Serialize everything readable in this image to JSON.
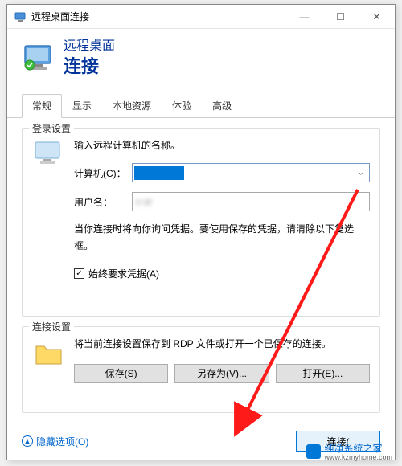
{
  "window_title": "远程桌面连接",
  "header": {
    "line1": "远程桌面",
    "line2": "连接"
  },
  "tabs": [
    "常规",
    "显示",
    "本地资源",
    "体验",
    "高级"
  ],
  "login_group": {
    "title": "登录设置",
    "prompt": "输入远程计算机的名称。",
    "computer_label": "计算机(C)：",
    "computer_value": "",
    "user_label": "用户名：",
    "user_value": "v                                              or",
    "note": "当你连接时将向你询问凭据。要使用保存的凭据，请清除以下复选框。",
    "checkbox_label": "始终要求凭据(A)",
    "checkbox_checked": "☑"
  },
  "connection_group": {
    "title": "连接设置",
    "desc": "将当前连接设置保存到 RDP 文件或打开一个已保存的连接。",
    "save_btn": "保存(S)",
    "saveas_btn": "另存为(V)...",
    "open_btn": "打开(E)..."
  },
  "footer": {
    "hide_options": "隐藏选项(O)",
    "connect_btn": "连接("
  },
  "watermark": {
    "text": "纯净系统之家",
    "sub": "www.kzmyhome.com"
  },
  "titlebar_controls": {
    "min": "—",
    "max": "☐",
    "close": "✕"
  }
}
